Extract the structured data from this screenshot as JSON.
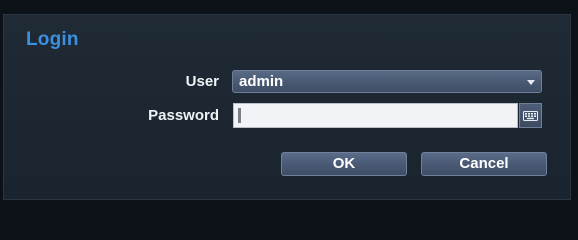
{
  "dialog": {
    "title": "Login",
    "title_color": "#3d8fe0"
  },
  "form": {
    "user": {
      "label": "User",
      "selected_value": "admin",
      "icon": "chevron-down-icon"
    },
    "password": {
      "label": "Password",
      "value": "",
      "keyboard_icon": "keyboard-icon"
    }
  },
  "buttons": {
    "ok_label": "OK",
    "cancel_label": "Cancel"
  }
}
